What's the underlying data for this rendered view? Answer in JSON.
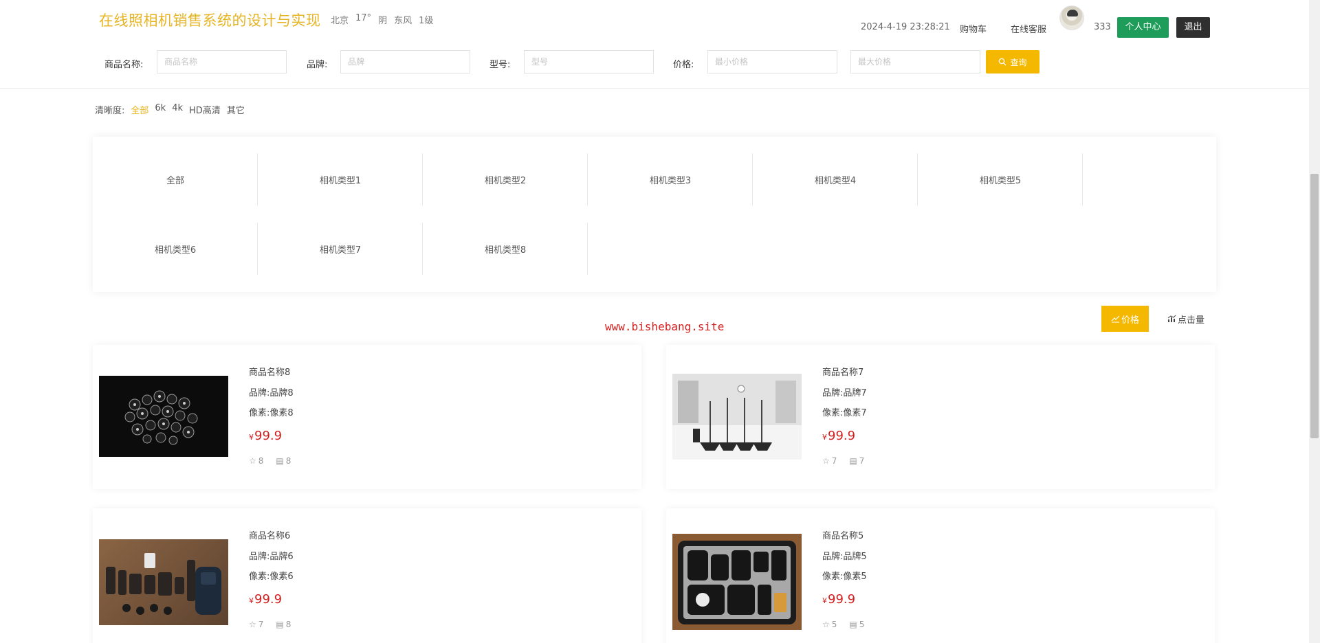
{
  "header": {
    "title": "在线照相机销售系统的设计与实现",
    "weather": {
      "city": "北京",
      "temp": "17°",
      "condition": "阴",
      "wind": "东风",
      "level": "1级"
    },
    "datetime": "2024-4-19 23:28:21",
    "cart_label": "购物车",
    "service_label": "在线客服",
    "username": "333",
    "center_label": "个人中心",
    "logout_label": "退出"
  },
  "search": {
    "name_label": "商品名称:",
    "name_placeholder": "商品名称",
    "brand_label": "品牌:",
    "brand_placeholder": "品牌",
    "model_label": "型号:",
    "model_placeholder": "型号",
    "price_label": "价格:",
    "min_placeholder": "最小价格",
    "max_placeholder": "最大价格",
    "button_label": "查询"
  },
  "resolution": {
    "label": "清晰度:",
    "options": [
      "全部",
      "6k",
      "4k",
      "HD高清",
      "其它"
    ],
    "active_index": 0
  },
  "categories": [
    "全部",
    "相机类型1",
    "相机类型2",
    "相机类型3",
    "相机类型4",
    "相机类型5",
    "相机类型6",
    "相机类型7",
    "相机类型8"
  ],
  "watermark": "www.bishebang.site",
  "sort": {
    "price_label": "价格",
    "clicks_label": "点击量"
  },
  "products": [
    {
      "name": "商品名称8",
      "brand": "品牌:品牌8",
      "pixels": "像素:像素8",
      "currency": "¥",
      "price": "99.9",
      "likes": "8",
      "comments": "8"
    },
    {
      "name": "商品名称7",
      "brand": "品牌:品牌7",
      "pixels": "像素:像素7",
      "currency": "¥",
      "price": "99.9",
      "likes": "7",
      "comments": "7"
    },
    {
      "name": "商品名称6",
      "brand": "品牌:品牌6",
      "pixels": "像素:像素6",
      "currency": "¥",
      "price": "99.9",
      "likes": "7",
      "comments": "8"
    },
    {
      "name": "商品名称5",
      "brand": "品牌:品牌5",
      "pixels": "像素:像素5",
      "currency": "¥",
      "price": "99.9",
      "likes": "5",
      "comments": "5"
    }
  ],
  "colors": {
    "accent": "#f5b800",
    "title": "#e6b422",
    "price": "#d21f1f",
    "green": "#1e9c5a"
  }
}
